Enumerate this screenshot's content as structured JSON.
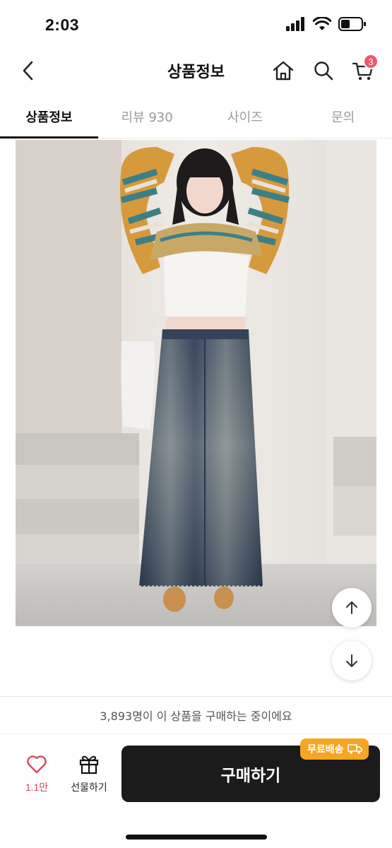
{
  "status_bar": {
    "time": "2:03"
  },
  "header": {
    "title": "상품정보",
    "cart_count": "3"
  },
  "tabs": [
    {
      "label": "상품정보",
      "active": true
    },
    {
      "label": "리뷰 930",
      "active": false
    },
    {
      "label": "사이즈",
      "active": false
    },
    {
      "label": "문의",
      "active": false
    }
  ],
  "purchase_notice": "3,893명이 이 상품을 구매하는 중이에요",
  "bottom_bar": {
    "like_count": "1.1만",
    "gift_label": "선물하기",
    "buy_label": "구매하기",
    "free_shipping_label": "무료배송"
  },
  "colors": {
    "accent_badge": "#f2566b",
    "like": "#e0445a",
    "free_shipping": "#f6a623",
    "buy_button": "#1b1b1b"
  },
  "icons": [
    "back-icon",
    "home-icon",
    "search-icon",
    "cart-icon",
    "heart-icon",
    "gift-icon",
    "truck-icon",
    "arrow-up-icon",
    "arrow-down-icon"
  ]
}
